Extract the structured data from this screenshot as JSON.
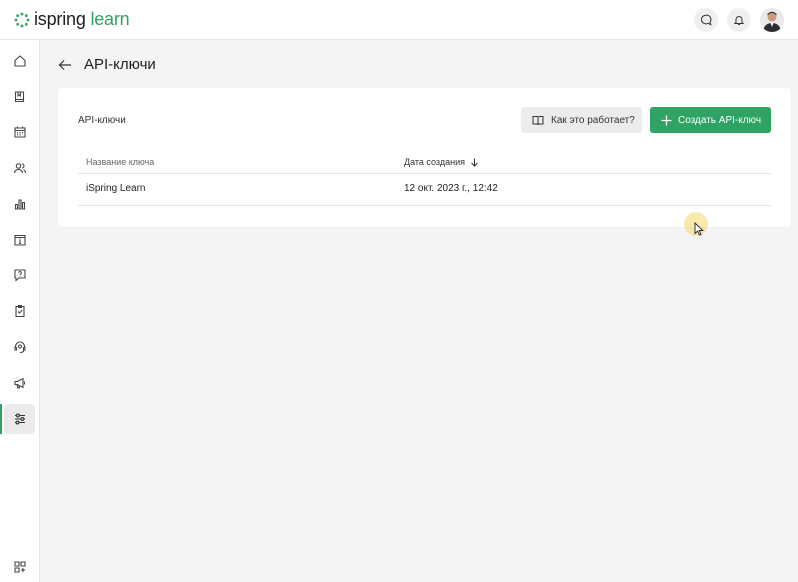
{
  "brand": {
    "logo_main": "ispring",
    "logo_accent": "learn",
    "accent_color": "#2fa363"
  },
  "topbar": {
    "icons": [
      "chat-icon",
      "bell-icon",
      "avatar"
    ]
  },
  "sidebar": {
    "items": [
      {
        "icon": "home-icon"
      },
      {
        "icon": "book-icon"
      },
      {
        "icon": "calendar-icon"
      },
      {
        "icon": "users-icon"
      },
      {
        "icon": "chart-icon"
      },
      {
        "icon": "info-icon"
      },
      {
        "icon": "question-icon"
      },
      {
        "icon": "clipboard-check-icon"
      },
      {
        "icon": "support-icon"
      },
      {
        "icon": "megaphone-icon"
      },
      {
        "icon": "settings-sliders-icon",
        "active": true
      },
      {
        "icon": "add-apps-icon"
      }
    ]
  },
  "page": {
    "title": "API-ключи"
  },
  "card": {
    "label": "API-ключи",
    "help_button": "Как это работает?",
    "create_button": "Создать API-ключ"
  },
  "table": {
    "columns": [
      "Название ключа",
      "Дата создания"
    ],
    "rows": [
      {
        "name": "iSpring Learn",
        "created": "12 окт. 2023 г., 12:42"
      }
    ]
  }
}
